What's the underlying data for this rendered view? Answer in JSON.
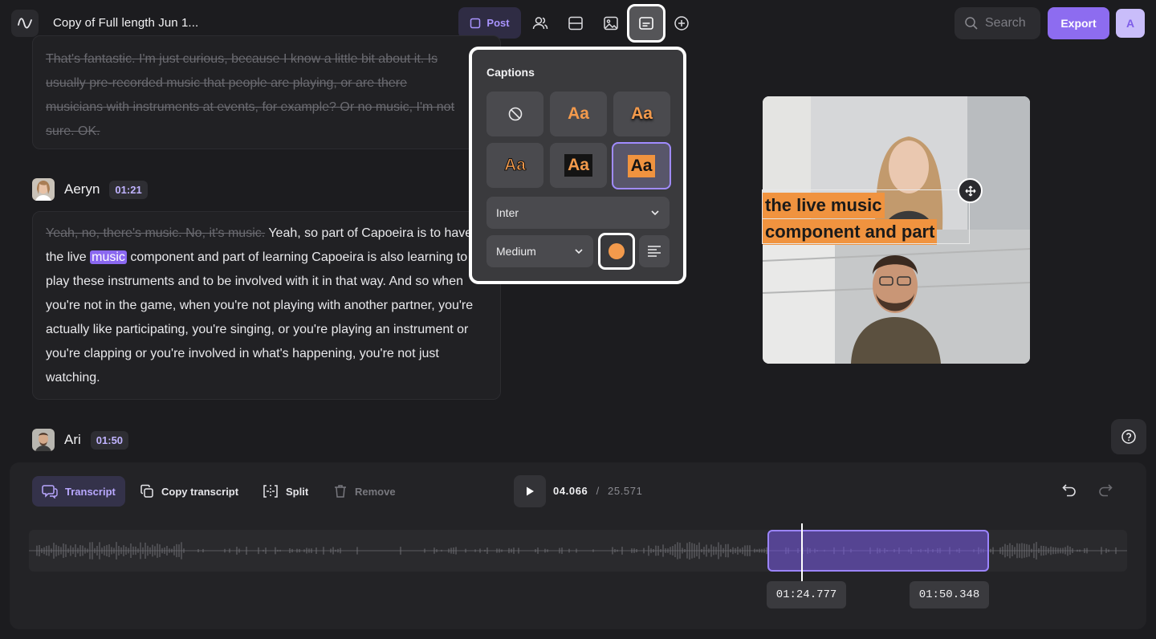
{
  "header": {
    "title": "Copy of Full length Jun 1...",
    "post_label": "Post",
    "search_placeholder": "Search",
    "export_label": "Export",
    "avatar_initial": "A"
  },
  "transcript": {
    "prev_block_lines": [
      "That's fantastic. I'm just curious, because I know a little bit about it. Is",
      "usually pre-recorded music that people are playing, or are there",
      "musicians with instruments at events, for example? Or no music, I'm not",
      "sure. OK."
    ],
    "speaker1": {
      "name": "Aeryn",
      "time": "01:21"
    },
    "block1": {
      "struck": "Yeah, no, there's music. No, it's music.",
      "pre": " Yeah, so part of Capoeira is to have the live ",
      "highlight": "music",
      "post": " component and part of learning Capoeira is also learning to play these instruments and to be involved with it in that way. And so when you're not in the game, when you're not playing with another partner, you're actually like participating, you're singing, or you're playing an instrument or you're clapping or you're involved in what's happening, you're not just watching."
    },
    "speaker2": {
      "name": "Ari",
      "time": "01:50"
    }
  },
  "captions_panel": {
    "title": "Captions",
    "style_sample": "Aa",
    "font": "Inter",
    "size": "Medium",
    "accent_color": "#f39a4c"
  },
  "preview": {
    "caption_line1": "the live music",
    "caption_line2": "component and part"
  },
  "bottom": {
    "transcript_label": "Transcript",
    "copy_label": "Copy transcript",
    "split_label": "Split",
    "remove_label": "Remove",
    "current_time": "04.066",
    "separator": "/",
    "duration": "25.571",
    "sel_start": "01:24.777",
    "sel_end": "01:50.348"
  },
  "colors": {
    "brand": "#8d6cf0",
    "caption_bg": "#f0933f"
  }
}
